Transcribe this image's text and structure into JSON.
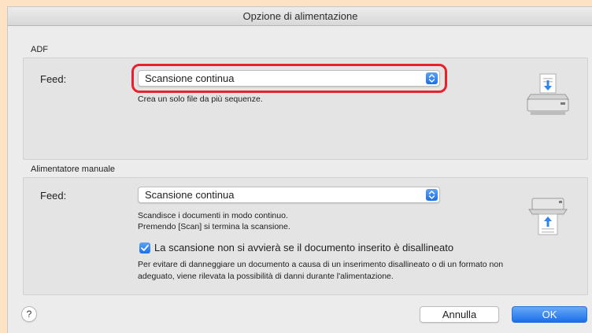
{
  "window": {
    "title": "Opzione di alimentazione"
  },
  "adf": {
    "section_label": "ADF",
    "feed_label": "Feed:",
    "feed_value": "Scansione continua",
    "description": "Crea un solo file da più sequenze."
  },
  "manual": {
    "section_label": "Alimentatore manuale",
    "feed_label": "Feed:",
    "feed_value": "Scansione continua",
    "description_line1": "Scandisce i documenti in modo continuo.",
    "description_line2": "Premendo [Scan] si termina la scansione.",
    "checkbox_checked": true,
    "checkbox_label": "La scansione non si avvierà se il documento inserito è disallineato",
    "checkbox_desc_line1": "Per evitare di danneggiare un documento a causa di un inserimento disallineato o di un formato non",
    "checkbox_desc_line2": "adeguato, viene rilevata la possibilità di danni durante l'alimentazione."
  },
  "footer": {
    "help_label": "?",
    "cancel_label": "Annulla",
    "ok_label": "OK"
  },
  "colors": {
    "background": "#fde3c4",
    "highlight": "#e8212e",
    "accent_blue": "#1a6fe8"
  },
  "icons": {
    "adf_icon": "scanner-feed-down-icon",
    "manual_icon": "scanner-feed-up-icon"
  }
}
